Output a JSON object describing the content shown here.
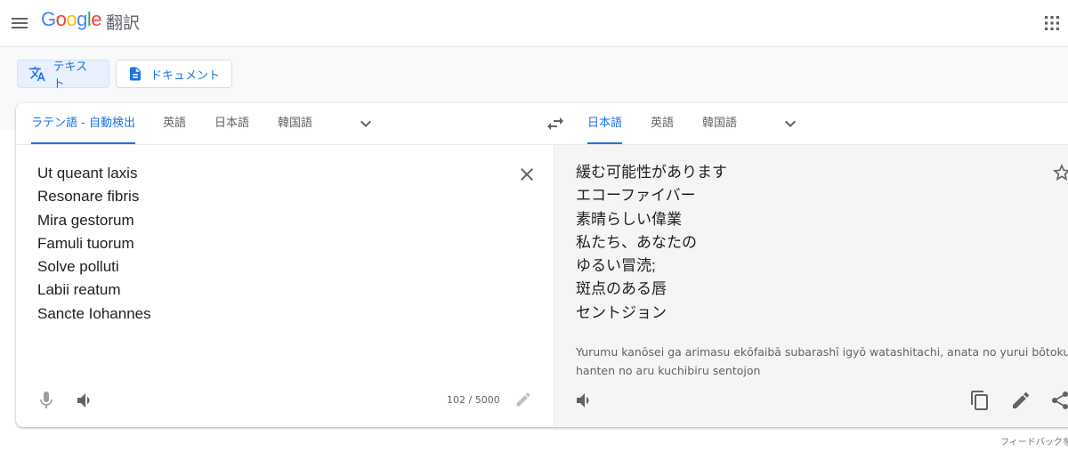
{
  "header": {
    "logo_letters": [
      {
        "ch": "G",
        "color": "#4285f4"
      },
      {
        "ch": "o",
        "color": "#ea4335"
      },
      {
        "ch": "o",
        "color": "#fbbc05"
      },
      {
        "ch": "g",
        "color": "#4285f4"
      },
      {
        "ch": "l",
        "color": "#34a853"
      },
      {
        "ch": "e",
        "color": "#ea4335"
      }
    ],
    "product": "翻訳",
    "icons": {
      "menu": "menu-icon",
      "apps": "apps-grid-icon"
    }
  },
  "modes": {
    "text_label": "テキスト",
    "document_label": "ドキュメント"
  },
  "source": {
    "tabs": [
      "ラテン語 - 自動検出",
      "英語",
      "日本語",
      "韓国語"
    ],
    "active_tab": 0,
    "lines": [
      "Ut queant laxis",
      "Resonare fibris",
      "Mira gestorum",
      "Famuli tuorum",
      "Solve polluti",
      "Labii reatum",
      "Sancte Iohannes"
    ],
    "char_count": "102 / 5000"
  },
  "target": {
    "tabs": [
      "日本語",
      "英語",
      "韓国語"
    ],
    "active_tab": 0,
    "lines": [
      "緩む可能性があります",
      "エコーファイバー",
      "素晴らしい偉業",
      "私たち、あなたの",
      "ゆるい冒涜;",
      "斑点のある唇",
      "セントジョン"
    ],
    "transliteration": "Yurumu kanōsei ga arimasu ekōfaibā subarashī igyō watashitachi, anata no yurui bōtoku hanten no aru kuchibiru sentojon"
  },
  "footer": {
    "feedback": "フィードバックを"
  },
  "colors": {
    "accent": "#1a73e8",
    "accent_bg": "#e8f0fe",
    "text": "#202124",
    "muted": "#5f6368"
  }
}
